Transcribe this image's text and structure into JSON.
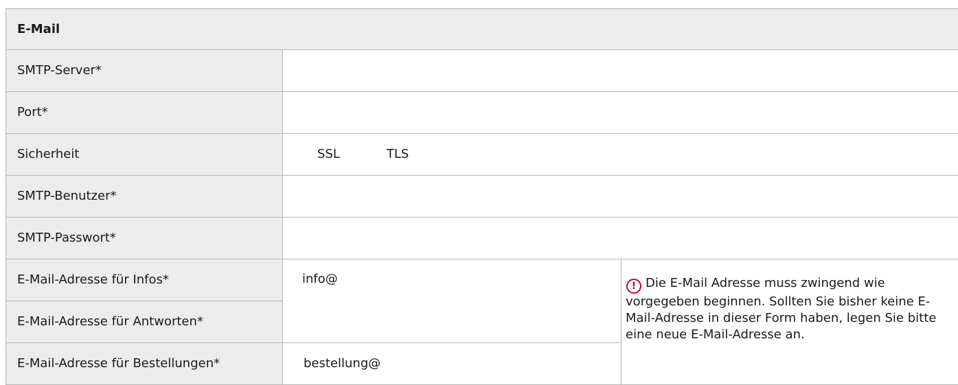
{
  "section": {
    "title": "E-Mail"
  },
  "fields": {
    "smtp_server": {
      "label": "SMTP-Server*",
      "value": ""
    },
    "port": {
      "label": "Port*",
      "value": ""
    },
    "security": {
      "label": "Sicherheit",
      "options": [
        "SSL",
        "TLS"
      ]
    },
    "smtp_user": {
      "label": "SMTP-Benutzer*",
      "value": ""
    },
    "smtp_password": {
      "label": "SMTP-Passwort*",
      "value": ""
    },
    "email_info": {
      "label": "E-Mail-Adresse für Infos*"
    },
    "email_answers": {
      "label": "E-Mail-Adresse für Antworten*"
    },
    "info_prefix": "info@",
    "email_orders": {
      "label": "E-Mail-Adresse für Bestellungen*"
    },
    "orders_prefix": "bestellung@"
  },
  "note": {
    "icon": "exclamation-circle-icon",
    "icon_glyph": "!",
    "text": "Die E-Mail Adresse muss zwingend wie vorgegeben beginnen. Sollten Sie bisher keine E-Mail-Adresse in dieser Form haben, legen Sie bitte eine neue E-Mail-Adresse an.",
    "color": "#d0021b"
  },
  "colors": {
    "label_bg": "#ececec",
    "border": "#b5b5b5"
  }
}
